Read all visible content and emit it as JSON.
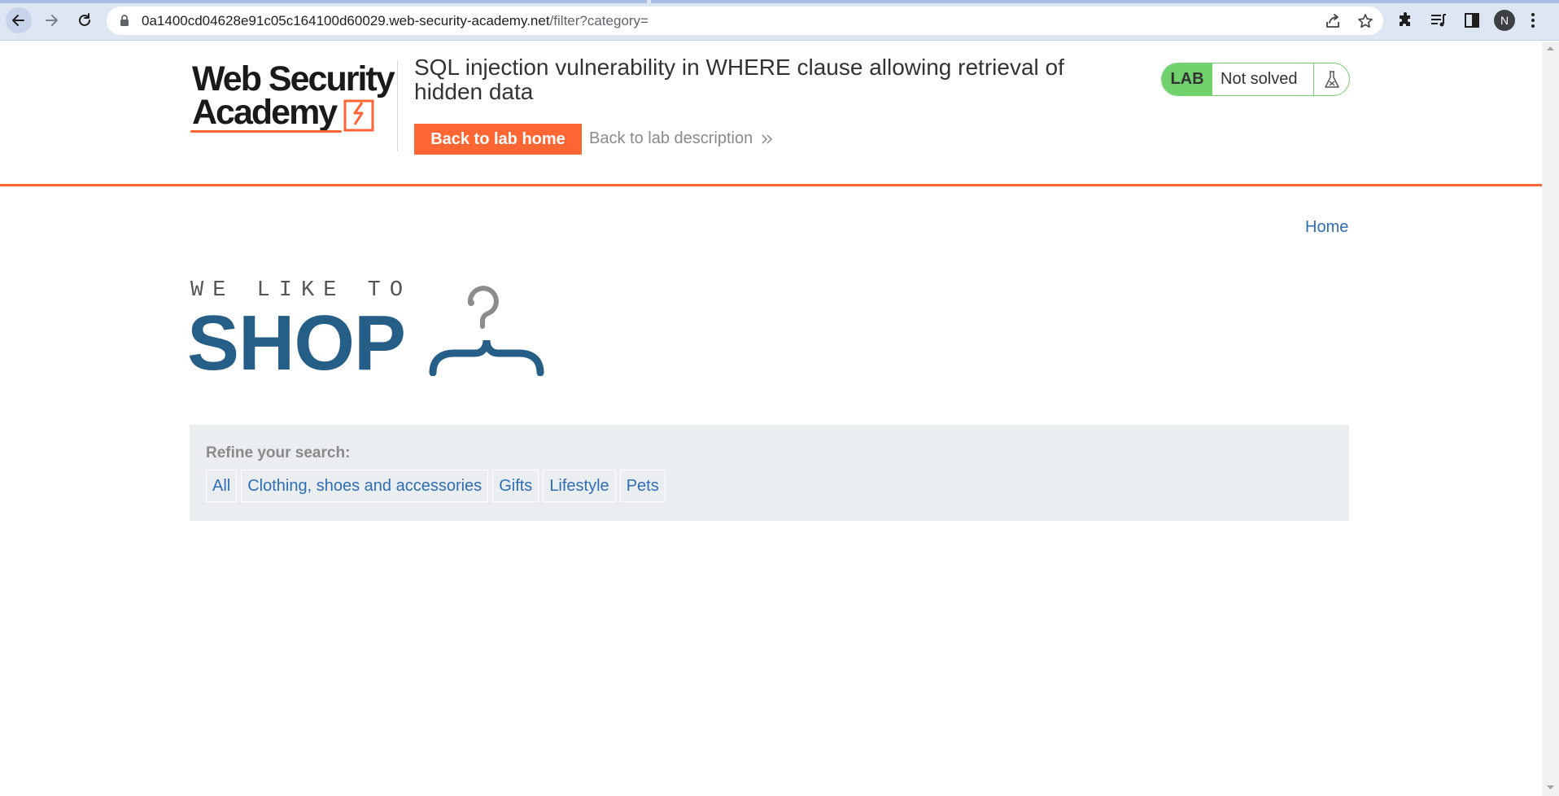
{
  "browser": {
    "url_host": "0a1400cd04628e91c05c164100d60029.web-security-academy.net",
    "url_path": "/filter?category=",
    "profile_initial": "N",
    "icons": [
      "back-icon",
      "forward-icon",
      "reload-icon",
      "lock-icon",
      "share-icon",
      "star-icon",
      "extensions-icon",
      "media-icon",
      "side-panel-icon",
      "menu-icon"
    ]
  },
  "lab_header": {
    "logo_line1": "Web Security",
    "logo_line2": "Academy",
    "title": "SQL injection vulnerability in WHERE clause allowing retrieval of hidden data",
    "back_home_label": "Back to lab home",
    "back_description_label": "Back to lab description",
    "lab_badge": "LAB",
    "status": "Not solved",
    "accent_color": "#ff6633",
    "status_color": "#70d16d"
  },
  "nav": {
    "home_label": "Home"
  },
  "shop_logo": {
    "tagline": "WE LIKE TO",
    "word": "SHOP",
    "color": "#255e86"
  },
  "filter": {
    "label": "Refine your search:",
    "categories": [
      "All",
      "Clothing, shoes and accessories",
      "Gifts",
      "Lifestyle",
      "Pets"
    ],
    "link_color": "#2f6db5"
  }
}
